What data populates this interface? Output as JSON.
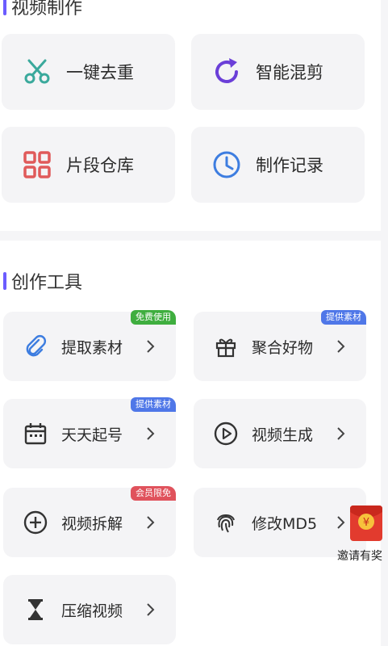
{
  "sections": [
    {
      "title": "视频制作"
    },
    {
      "title": "创作工具"
    }
  ],
  "video_make": [
    {
      "label": "一键去重",
      "icon": "scissors-icon",
      "color": "#3aa99c"
    },
    {
      "label": "智能混剪",
      "icon": "refresh-icon",
      "color": "#6b3fd8"
    },
    {
      "label": "片段仓库",
      "icon": "grid-icon",
      "color": "#e05a5a"
    },
    {
      "label": "制作记录",
      "icon": "clock-icon",
      "color": "#3d7de0"
    }
  ],
  "tools": [
    {
      "label": "提取素材",
      "icon": "paperclip-icon",
      "badge": "免费使用",
      "badge_color": "#3fae3f"
    },
    {
      "label": "聚合好物",
      "icon": "gift-icon",
      "badge": "提供素材",
      "badge_color": "#4f77e8"
    },
    {
      "label": "天天起号",
      "icon": "calendar-icon",
      "badge": "提供素材",
      "badge_color": "#4f77e8"
    },
    {
      "label": "视频生成",
      "icon": "play-icon",
      "badge": "",
      "badge_color": ""
    },
    {
      "label": "视频拆解",
      "icon": "plus-circle-icon",
      "badge": "会员限免",
      "badge_color": "#e0525c"
    },
    {
      "label": "修改MD5",
      "icon": "fingerprint-icon",
      "badge": "",
      "badge_color": ""
    },
    {
      "label": "压缩视频",
      "icon": "hourglass-icon",
      "badge": "",
      "badge_color": ""
    }
  ],
  "floating": {
    "text": "邀请有奖",
    "icon": "red-envelope-icon",
    "symbol": "¥"
  }
}
